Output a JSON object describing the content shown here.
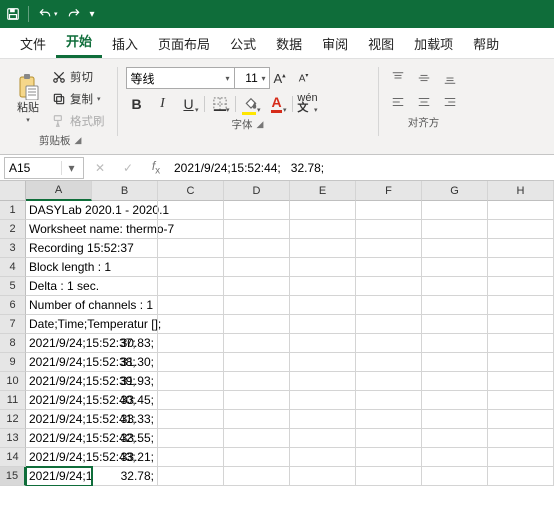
{
  "titlebar": {
    "save_icon": "save-icon",
    "undo_icon": "undo-icon",
    "redo_icon": "redo-icon"
  },
  "tabs": [
    "文件",
    "开始",
    "插入",
    "页面布局",
    "公式",
    "数据",
    "审阅",
    "视图",
    "加载项",
    "帮助"
  ],
  "active_tab": 1,
  "clipboard": {
    "paste": "粘贴",
    "cut": "剪切",
    "copy": "复制",
    "format_painter": "格式刷",
    "group": "剪贴板"
  },
  "font": {
    "name": "等线",
    "size": "11",
    "group": "字体"
  },
  "align": {
    "group": "对齐方"
  },
  "namebox": "A15",
  "formula": "2021/9/24;15:52:44;   32.78;",
  "colheads": [
    "A",
    "B",
    "C",
    "D",
    "E",
    "F",
    "G",
    "H"
  ],
  "rows": [
    {
      "n": "1",
      "a_ov": "DASYLab 2020.1 - 2020.1"
    },
    {
      "n": "2",
      "a_ov": "Worksheet name: thermo-7"
    },
    {
      "n": "3",
      "a_ov": "Recording  15:52:37"
    },
    {
      "n": "4",
      "a_ov": "Block length       : 1"
    },
    {
      "n": "5",
      "a_ov": "Delta            : 1 sec."
    },
    {
      "n": "6",
      "a_ov": "Number of channels : 1"
    },
    {
      "n": "7",
      "a_ov": "Date;Time;Temperatur [];"
    },
    {
      "n": "8",
      "a_ov": "2021/9/24;15:52:37;",
      "b": "30.83;"
    },
    {
      "n": "9",
      "a_ov": "2021/9/24;15:52:38;",
      "b": "31.30;"
    },
    {
      "n": "10",
      "a_ov": "2021/9/24;15:52:39;",
      "b": "31.93;"
    },
    {
      "n": "11",
      "a_ov": "2021/9/24;15:52:40;",
      "b": "33.45;"
    },
    {
      "n": "12",
      "a_ov": "2021/9/24;15:52:41;",
      "b": "33.33;"
    },
    {
      "n": "13",
      "a_ov": "2021/9/24;15:52:42;",
      "b": "33.55;"
    },
    {
      "n": "14",
      "a_ov": "2021/9/24;15:52:43;",
      "b": "33.21;"
    },
    {
      "n": "15",
      "a": "2021/9/24;15:52:44",
      "b": "32.78;",
      "active": true
    }
  ]
}
